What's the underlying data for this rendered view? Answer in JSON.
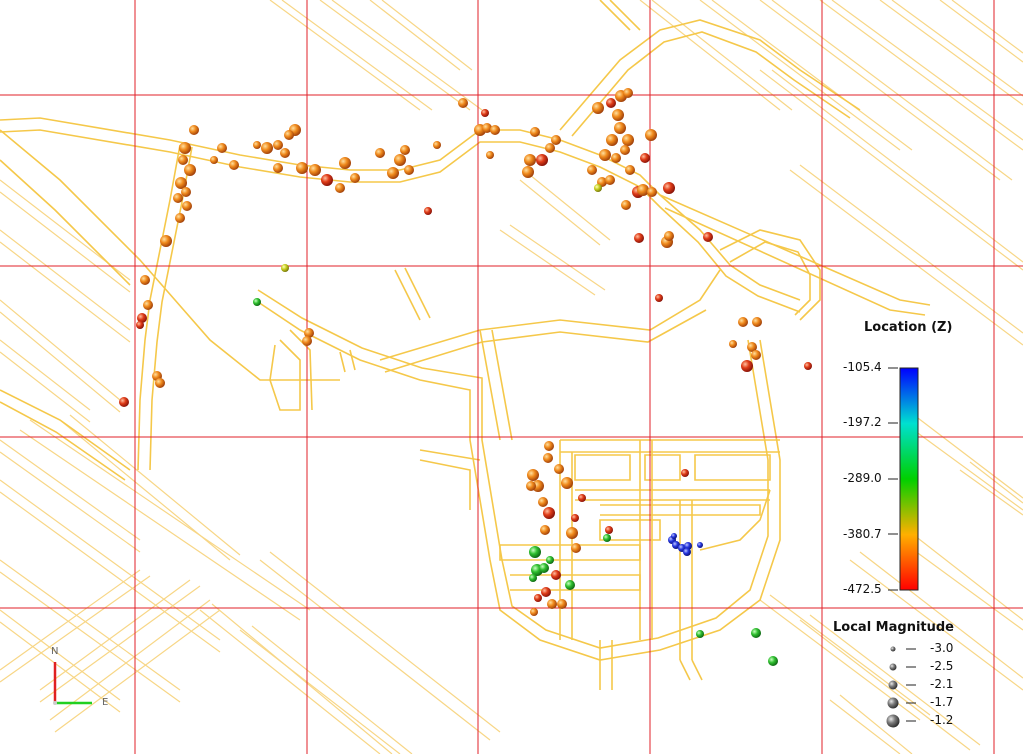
{
  "legend": {
    "color_title": "Location (Z)",
    "color_ticks": [
      "-105.4",
      "-197.2",
      "-289.0",
      "-380.7",
      "-472.5"
    ],
    "color_range": [
      -472.5,
      -105.4
    ],
    "size_title": "Local Magnitude",
    "size_ticks": [
      "-3.0",
      "-2.5",
      "-2.1",
      "-1.7",
      "-1.2"
    ]
  },
  "compass": {
    "north": "N",
    "east": "E"
  },
  "colors": {
    "grid": "#e0202a",
    "drifts": "#f5c84a",
    "low_z": "#e8321c",
    "high_z": "#1c2cf0"
  },
  "chart_data": {
    "type": "scatter",
    "title": "",
    "xlabel": "",
    "ylabel": "",
    "color_by": "Location (Z)",
    "size_by": "Local Magnitude",
    "groups": [
      {
        "name": "north-west drift cluster",
        "z_approx": -455,
        "count": 38
      },
      {
        "name": "north-central drift cluster",
        "z_approx": -450,
        "count": 30
      },
      {
        "name": "north-east ramp cluster",
        "z_approx": -460,
        "count": 28
      },
      {
        "name": "east ramp events",
        "z_approx": -455,
        "count": 7
      },
      {
        "name": "south-central stope cluster",
        "z_approx": -440,
        "count": 30
      },
      {
        "name": "south-central green events",
        "z_approx": -330,
        "count": 8
      },
      {
        "name": "south-east blue events",
        "z_approx": -130,
        "count": 7
      },
      {
        "name": "south-east green events",
        "z_approx": -330,
        "count": 3
      }
    ]
  }
}
